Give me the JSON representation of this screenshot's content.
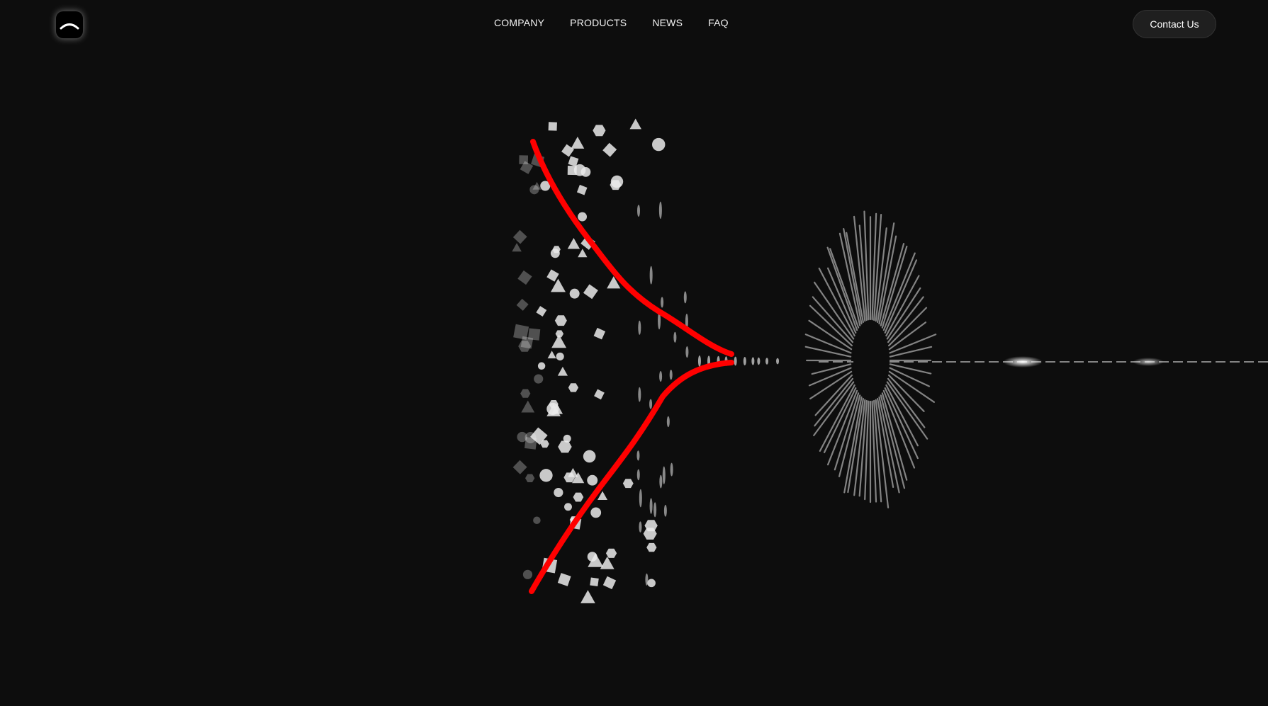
{
  "header": {
    "logo_icon": "arc-logo-icon",
    "nav": [
      {
        "label": "COMPANY"
      },
      {
        "label": "PRODUCTS"
      },
      {
        "label": "NEWS"
      },
      {
        "label": "FAQ"
      }
    ],
    "contact_label": "Contact Us"
  },
  "hero": {
    "animation": "particle-funnel-animation",
    "annotation_color": "#ff0000"
  }
}
